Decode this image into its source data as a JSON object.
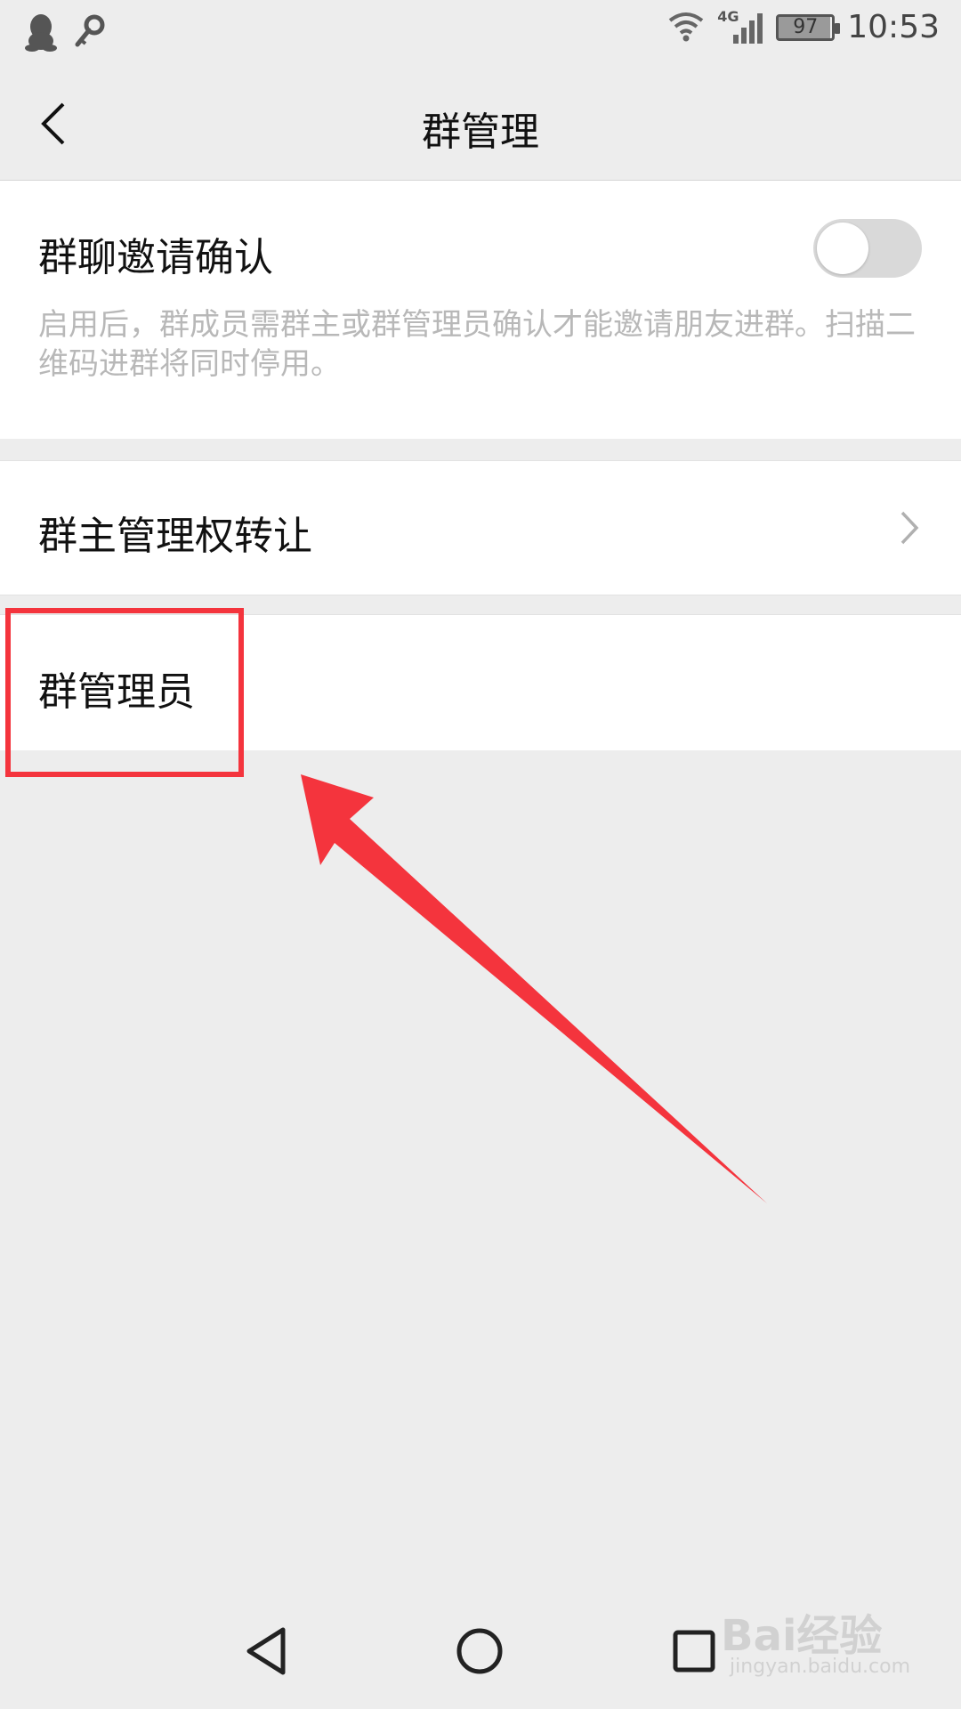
{
  "status_bar": {
    "icons_left": [
      "qq-penguin-icon",
      "key-icon"
    ],
    "icons_right": [
      "wifi-icon",
      "cellular-4g-icon"
    ],
    "network_label": "4G",
    "battery_level": "97",
    "time": "10:53"
  },
  "nav": {
    "title": "群管理",
    "back_icon": "chevron-left-icon"
  },
  "settings": {
    "invite_confirm": {
      "label": "群聊邀请确认",
      "description": "启用后，群成员需群主或群管理员确认才能邀请朋友进群。扫描二维码进群将同时停用。",
      "toggle_on": false
    },
    "transfer_owner": {
      "label": "群主管理权转让",
      "chevron_icon": "chevron-right-icon"
    },
    "admins": {
      "label": "群管理员"
    }
  },
  "annotation": {
    "color": "#f4343d",
    "target": "admins"
  },
  "android_nav": [
    "back-triangle-icon",
    "home-circle-icon",
    "recents-square-icon"
  ],
  "watermark": {
    "main": "Bai经验",
    "sub": "jingyan.baidu.com"
  },
  "colors": {
    "background": "#ededed",
    "card": "#ffffff",
    "text": "#111111",
    "muted": "#b8b8b8",
    "toggle_off": "#d9d9d9"
  }
}
